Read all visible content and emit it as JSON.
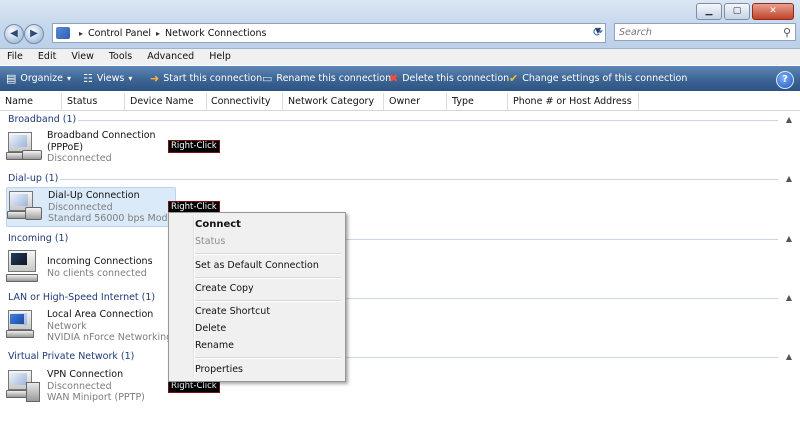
{
  "window": {
    "minimize": "▁",
    "maximize": "▢",
    "close": "✕"
  },
  "nav": {
    "back": "◀",
    "forward": "▶"
  },
  "address": {
    "segments": [
      "Control Panel",
      "Network Connections"
    ],
    "separator": "▸"
  },
  "search": {
    "placeholder": "Search"
  },
  "menu": [
    "File",
    "Edit",
    "View",
    "Tools",
    "Advanced",
    "Help"
  ],
  "toolbar": {
    "organize": "Organize",
    "views": "Views",
    "start": "Start this connection",
    "rename": "Rename this connection",
    "delete": "Delete this connection",
    "change": "Change settings of this connection",
    "help": "?"
  },
  "columns": [
    "Name",
    "Status",
    "Device Name",
    "Connectivity",
    "Network Category",
    "Owner",
    "Type",
    "Phone # or Host Address"
  ],
  "groups": [
    {
      "title": "Broadband (1)",
      "items": [
        {
          "name": "Broadband Connection",
          "name2": "(PPPoE)",
          "status": "Disconnected",
          "device": ""
        }
      ]
    },
    {
      "title": "Dial-up (1)",
      "items": [
        {
          "name": "Dial-Up Connection",
          "status": "Disconnected",
          "device": "Standard 56000 bps Modem"
        }
      ]
    },
    {
      "title": "Incoming (1)",
      "items": [
        {
          "name": "Incoming Connections",
          "status": "No clients connected"
        }
      ]
    },
    {
      "title": "LAN or High-Speed Internet (1)",
      "items": [
        {
          "name": "Local Area Connection",
          "status": "Network",
          "device": "NVIDIA nForce Networking ..."
        }
      ]
    },
    {
      "title": "Virtual Private Network (1)",
      "items": [
        {
          "name": "VPN Connection",
          "status": "Disconnected",
          "device": "WAN Miniport (PPTP)"
        }
      ]
    }
  ],
  "annotation": "Right-Click",
  "context_menu": [
    "Connect",
    "Status",
    "Set as Default Connection",
    "Create Copy",
    "Create Shortcut",
    "Delete",
    "Rename",
    "Properties"
  ],
  "colors": {
    "commandbar": "#3f6796",
    "group_title": "#1e3a78",
    "selection": "#dbeaf9"
  }
}
